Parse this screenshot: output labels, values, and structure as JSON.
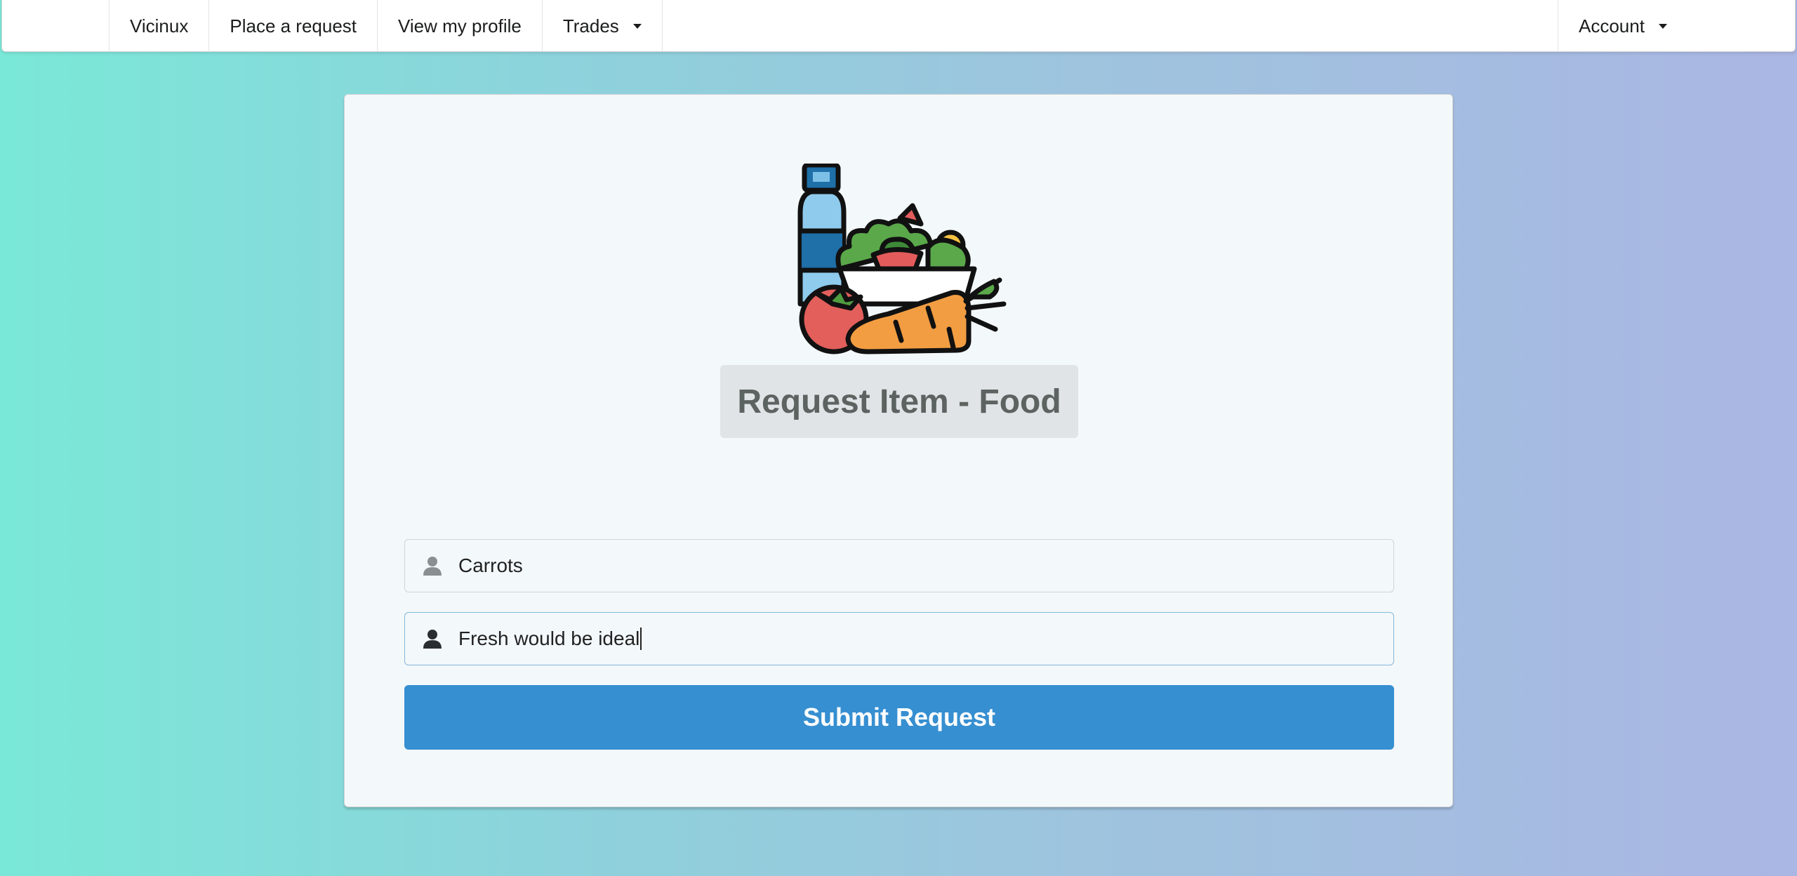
{
  "nav": {
    "brand": "Vicinux",
    "place_request": "Place a request",
    "view_profile": "View my profile",
    "trades": "Trades",
    "account": "Account"
  },
  "form": {
    "title": "Request Item - Food",
    "item_value": "Carrots",
    "details_value": "Fresh would be ideal",
    "submit_label": "Submit Request"
  },
  "icons": {
    "illustration": "food-groceries-illustration",
    "field_icon": "user-icon",
    "dropdown": "caret-down-icon"
  },
  "colors": {
    "primary_button": "#368fd1",
    "card_background": "#f3f8fa",
    "title_background": "#e0e4e6"
  }
}
